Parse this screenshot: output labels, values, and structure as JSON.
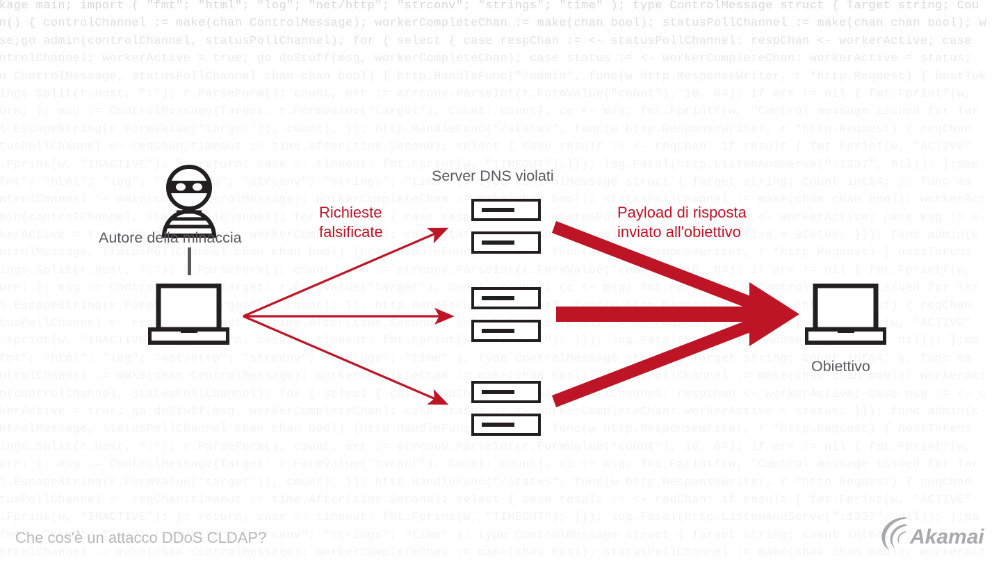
{
  "diagram": {
    "title_caption": "Che cos'è un attacco DDoS CLDAP?",
    "colors": {
      "accent_red": "#bd1426",
      "label_gray": "#58595b",
      "icon_black": "#231f20",
      "background": "#ffffff",
      "code_text": "#efefef",
      "logo_gray": "#a7a9ac",
      "caption_gray": "#b9b9b9"
    },
    "nodes": [
      {
        "id": "attacker",
        "label": "Autore della minaccia",
        "icon": "burglar-icon"
      },
      {
        "id": "servers",
        "label": "Server DNS violati",
        "icon": "server-stack-icon",
        "count": 6
      },
      {
        "id": "target",
        "label": "Obiettivo",
        "icon": "laptop-icon"
      }
    ],
    "flows": [
      {
        "id": "spoofed-requests",
        "label_line1": "Richieste",
        "label_line2": "falsificate",
        "from": "attacker",
        "to": "servers",
        "style": "thin",
        "arrow_count": 3
      },
      {
        "id": "response-payload",
        "label_line1": "Payload di risposta",
        "label_line2": "inviato all'obiettivo",
        "from": "servers",
        "to": "target",
        "style": "thick",
        "arrow_count": 3
      }
    ],
    "logo": {
      "name": "akamai-logo",
      "text": "Akamai"
    }
  },
  "background_code": [
    "ckage main; import ( \"fmt\"; \"html\"; \"log\"; \"net/http\"; \"strconv\"; \"strings\"; \"time\" ); type ControlMessage struct { Target string; Cou",
    "in() { controlChannel := make(chan ControlMessage); workerCompleteChan := make(chan bool); statusPollChannel := make(chan chan bool); w",
    "lse;go admin(controlChannel, statusPollChannel); for { select { case respChan := <- statusPollChannel: respChan <- workerActive; case",
    "ontrolChannel; workerActive = true; go doStuff(msg, workerCompleteChan); case status := <- workerCompleteChan: workerActive = status;",
    "an ControlMessage, statusPollChannel chan chan bool) { http.HandleFunc(\"/admin\", func(w http.ResponseWriter, r *http.Request) { hostTok",
    "rings.Split(r.Host, \":\"); r.ParseForm(); count, err := strconv.ParseInt(r.FormValue(\"count\"), 10, 64); if err != nil { fmt.Fprintf(w,",
    "turn; }; msg := ControlMessage{Target: r.FormValue(\"target\"), Count: count}; cc <- msg; fmt.Fprintf(w, \"Control message issued for Tar",
    "ml.EscapeString(r.FormValue(\"target\")), count); }); http.HandleFunc(\"/status\", func(w http.ResponseWriter, r *http.Request) { reqChan",
    "atusPollChannel <- reqChan;timeout := time.After(time.Second); select { case result := <- reqChan: if result { fmt.Fprint(w, \"ACTIVE\"",
    "t.Fprint(w, \"INACTIVE\"); }; return; case <- timeout: fmt.Fprint(w, \"TIMEOUT\");}}); log.Fatal(http.ListenAndServe(\":1337\", nil)); };pac",
    "\"fmt\"; \"html\"; \"log\"; \"net/http\"; \"strconv\"; \"strings\"; \"time\" ); type ControlMessage struct { Target string; Count int64; }; func ma",
    "ontrolChannel := make(chan ControlMessage); workerCompleteChan := make(chan bool); statusPollChannel := make(chan chan bool); workerAct",
    "dmin(controlChannel, statusPollChannel); for { select { case respChan := <- statusPollChannel: respChan <- workerActive; case msg := <-",
    "rkerActive = true; go doStuff(msg, workerCompleteChan); case status := <- workerCompleteChan: workerActive = status; }}}; func admin(c",
    "ontrolMessage, statusPollChannel chan chan bool) {http.HandleFunc(\"/admin\", func(w http.ResponseWriter, r *http.Request) { hostTokens",
    "rings.Split(r.Host, \":\"); r.ParseForm(); count, err := strconv.ParseInt(r.FormValue(\"count\"), 10, 64); if err != nil { fmt.Fprintf(w,",
    "turn; }; msg := ControlMessage{Target: r.FormValue(\"target\"), Count: count}; cc <- msg; fmt.Fprintf(w, \"Control message issued for Tar",
    "ml.EscapeString(r.FormValue(\"target\")), count); }); http.HandleFunc(\"/status\", func(w http.ResponseWriter, r *http.Request) { reqChan",
    "atusPollChannel <- reqChan;timeout := time.After(time.Second); select { case result := <- reqChan: if result { fmt.Fprint(w, \"ACTIVE\"",
    "t.Fprint(w, \"INACTIVE\"); }; return; case <- timeout: fmt.Fprint(w, \"TIMEOUT\"); }}); log.Fatal(http.ListenAndServe(\":1337\", nil)); };pa",
    "\"fmt\"; \"html\"; \"log\"; \"net/http\"; \"strconv\"; \"strings\"; \"time\" ); type ControlMessage struct { Target string; Count int64; }; func ma",
    "ontrolChannel := make(chan ControlMessage); workerCompleteChan := make(chan bool); statusPollChannel := make(chan chan bool); workerAct",
    "in(controlChannel, statusPollChannel); for { select { case respChan := <- statusPollChannel: respChan <- workerActive; case msg := <- c",
    "rkerActive = true; go doStuff(msg, workerCompleteChan); case status := <- workerCompleteChan: workerActive = status; }}}; func admin(c",
    "ontrolMessage, statusPollChannel chan chan bool) {http.HandleFunc(\"/admin\", func(w http.ResponseWriter, r *http.Request) { hostTokens",
    "rings.Split(r.Host, \":\"); r.ParseForm(); count, err := strconv.ParseInt(r.FormValue(\"count\"), 10, 64); if err != nil { fmt.Fprintf(w,",
    "turn; }; msg := ControlMessage{Target: r.FormValue(\"target\"), Count: count}; cc <- msg; fmt.Fprintf(w, \"Control message issued for Tar",
    "ml.EscapeString(r.FormValue(\"target\")), count); }); http.HandleFunc(\"/status\", func(w http.ResponseWriter, r *http.Request) { reqChan",
    "atusPollChannel <- reqChan;timeout := time.After(time.Second); select { case result := <- reqChan: if result { fmt.Fprint(w, \"ACTIVE\"",
    "t.Fprint(w, \"INACTIVE\"); }; return; case <- timeout: fmt.Fprint(w, \"TIMEOUT\"); }}); log.Fatal(http.ListenAndServe(\":1337\", nil)); };pa",
    "\"fmt\"; \"html\"; \"log\"; \"net/http\"; \"strconv\"; \"strings\"; \"time\" ); type ControlMessage struct { Target string; Count int64; }; func ma",
    "ontrolChannel := make(chan ControlMessage); workerCompleteChan := make(chan bool); statusPollChannel := make(chan chan bool); workerAct"
  ]
}
